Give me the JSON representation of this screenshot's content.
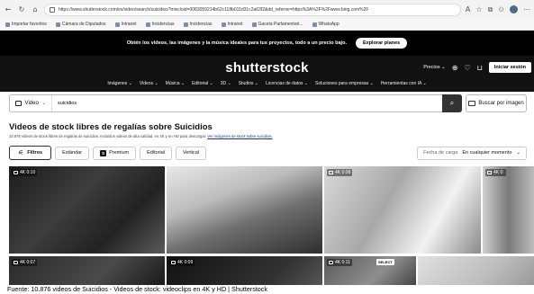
{
  "browser": {
    "url": "https://www.shutterstock.com/es/video/search/suicidios?mixcloid=0083059214b62c118b011d31c2a63f2&dd_referrer=https%3A%2F%2Fwww.bing.com%2F",
    "back_icon": "back-arrow-icon",
    "bookmarks": [
      {
        "label": "Importar favoritos"
      },
      {
        "label": "Cámara de Diputados"
      },
      {
        "label": "Intranet"
      },
      {
        "label": "Incidencias"
      },
      {
        "label": "Incidencias"
      },
      {
        "label": "Intranet"
      },
      {
        "label": "Gaceta Parlamentari..."
      },
      {
        "label": "WhatsApp"
      }
    ]
  },
  "promo": {
    "text": "Obtén los videos, las imágenes y la música ideales para tus proyectos, todo a un precio bajo.",
    "button": "Explorar planes"
  },
  "header": {
    "logo": "shutterstock",
    "pricing": "Precios ⌄",
    "login": "Iniciar sesión",
    "nav": [
      "Imágenes ⌄",
      "Videos ⌄",
      "Música ⌄",
      "Editorial ⌄",
      "3D ⌄",
      "Studios ⌄",
      "Licencias de datos ⌄",
      "Soluciones para empresas ⌄",
      "Herramientas con IA ⌄"
    ]
  },
  "search": {
    "type": "Video",
    "query": "suicidios",
    "image_search": "Buscar por imagen"
  },
  "page": {
    "title": "Videos de stock libres de regalías sobre Suicidios",
    "subtitle": "10.876 videos de stock libres de regalías de suicidios. Incluidos videos de alta calidad, en 4K y en HD para descargar. ",
    "subtitle_link": "Ver imágenes de stock sobre suicidios."
  },
  "filters": {
    "filters_button": "Filtros",
    "chips": [
      "Estándar",
      "Premium",
      "Editorial",
      "Vertical"
    ],
    "premium_letter": "S",
    "sort_label": "Fecha de carga",
    "sort_value": "En cualquier momento"
  },
  "videos": [
    {
      "badge": "4K 0:10",
      "tone": "dark"
    },
    {
      "badge": "",
      "tone": "mid"
    },
    {
      "badge": "4K 0:08",
      "tone": "light"
    },
    {
      "badge": "4K 0:",
      "tone": "light2"
    },
    {
      "badge": "4K 0:07",
      "tone": "dark"
    },
    {
      "badge": "4K 0:09",
      "tone": "dark2"
    },
    {
      "badge": "4K 0:11",
      "tone": "mid2",
      "select": "SELECT"
    },
    {
      "badge": "",
      "tone": "light"
    }
  ],
  "caption": "Fuente: 10.876 videos de Suicidios - Videos de stock: videoclips en 4K y HD | Shutterstock"
}
